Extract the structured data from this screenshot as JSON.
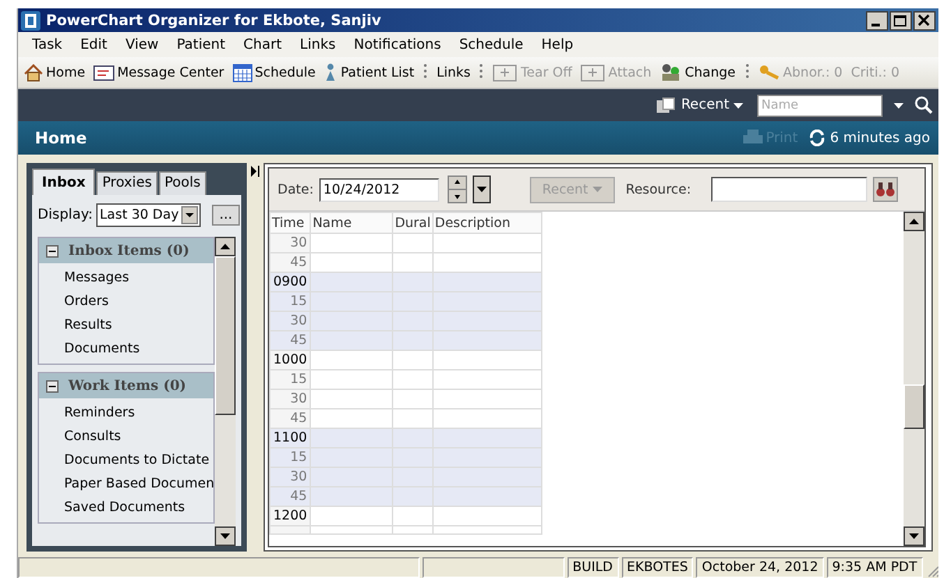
{
  "window": {
    "title": "PowerChart Organizer for Ekbote, Sanjiv"
  },
  "menu": [
    "Task",
    "Edit",
    "View",
    "Patient",
    "Chart",
    "Links",
    "Notifications",
    "Schedule",
    "Help"
  ],
  "toolbar": [
    {
      "kind": "button",
      "label": "Home",
      "disabled": false
    },
    {
      "kind": "button",
      "label": "Message Center",
      "disabled": false
    },
    {
      "kind": "button",
      "label": "Schedule",
      "disabled": false
    },
    {
      "kind": "button",
      "label": "Patient List",
      "disabled": false
    },
    {
      "kind": "separator"
    },
    {
      "kind": "button",
      "label": "Links",
      "disabled": false
    },
    {
      "kind": "separator"
    },
    {
      "kind": "button",
      "label": "Tear Off",
      "disabled": true
    },
    {
      "kind": "button",
      "label": "Attach",
      "disabled": true
    },
    {
      "kind": "button",
      "label": "Change",
      "disabled": false
    },
    {
      "kind": "separator"
    },
    {
      "kind": "button",
      "label": "Abnor.: 0",
      "disabled": true
    },
    {
      "kind": "button",
      "label": "Criti.: 0",
      "disabled": true
    }
  ],
  "nav": {
    "recent": "Recent",
    "search": {
      "placeholder": "Name"
    }
  },
  "page": {
    "title": "Home",
    "print": {
      "label": "Print",
      "disabled": true
    },
    "refresh": "6 minutes ago"
  },
  "left": {
    "tabs": [
      {
        "label": "Inbox",
        "selected": true
      },
      {
        "label": "Proxies",
        "selected": false
      },
      {
        "label": "Pools",
        "selected": false
      }
    ],
    "display_label": "Display:",
    "display_value": "Last 30 Day",
    "more": "...",
    "sections": [
      {
        "title": "Inbox Items (0)",
        "expanded": true,
        "items": [
          "Messages",
          "Orders",
          "Results",
          "Documents"
        ]
      },
      {
        "title": "Work Items (0)",
        "expanded": true,
        "items": [
          "Reminders",
          "Consults",
          "Documents to Dictate",
          "Paper Based Documen",
          "Saved Documents"
        ]
      }
    ]
  },
  "schedule": {
    "date_label": "Date:",
    "date": "10/24/2012",
    "recent": {
      "label": "Recent",
      "disabled": true
    },
    "resource_label": "Resource:",
    "columns": [
      "Time",
      "Name",
      "Dural",
      "Description"
    ],
    "rows": [
      {
        "time": "30",
        "kind": "quarter",
        "shaded": false
      },
      {
        "time": "45",
        "kind": "quarter",
        "shaded": false
      },
      {
        "time": "0900",
        "kind": "hour",
        "shaded": true
      },
      {
        "time": "15",
        "kind": "quarter",
        "shaded": true
      },
      {
        "time": "30",
        "kind": "quarter",
        "shaded": true
      },
      {
        "time": "45",
        "kind": "quarter",
        "shaded": true
      },
      {
        "time": "1000",
        "kind": "hour",
        "shaded": false
      },
      {
        "time": "15",
        "kind": "quarter",
        "shaded": false
      },
      {
        "time": "30",
        "kind": "quarter",
        "shaded": false
      },
      {
        "time": "45",
        "kind": "quarter",
        "shaded": false
      },
      {
        "time": "1100",
        "kind": "hour",
        "shaded": true
      },
      {
        "time": "15",
        "kind": "quarter",
        "shaded": true
      },
      {
        "time": "30",
        "kind": "quarter",
        "shaded": true
      },
      {
        "time": "45",
        "kind": "quarter",
        "shaded": true
      },
      {
        "time": "1200",
        "kind": "hour",
        "shaded": false
      }
    ]
  },
  "status_bar": [
    "BUILD",
    "EKBOTES",
    "October 24, 2012",
    "9:35 AM PDT"
  ]
}
